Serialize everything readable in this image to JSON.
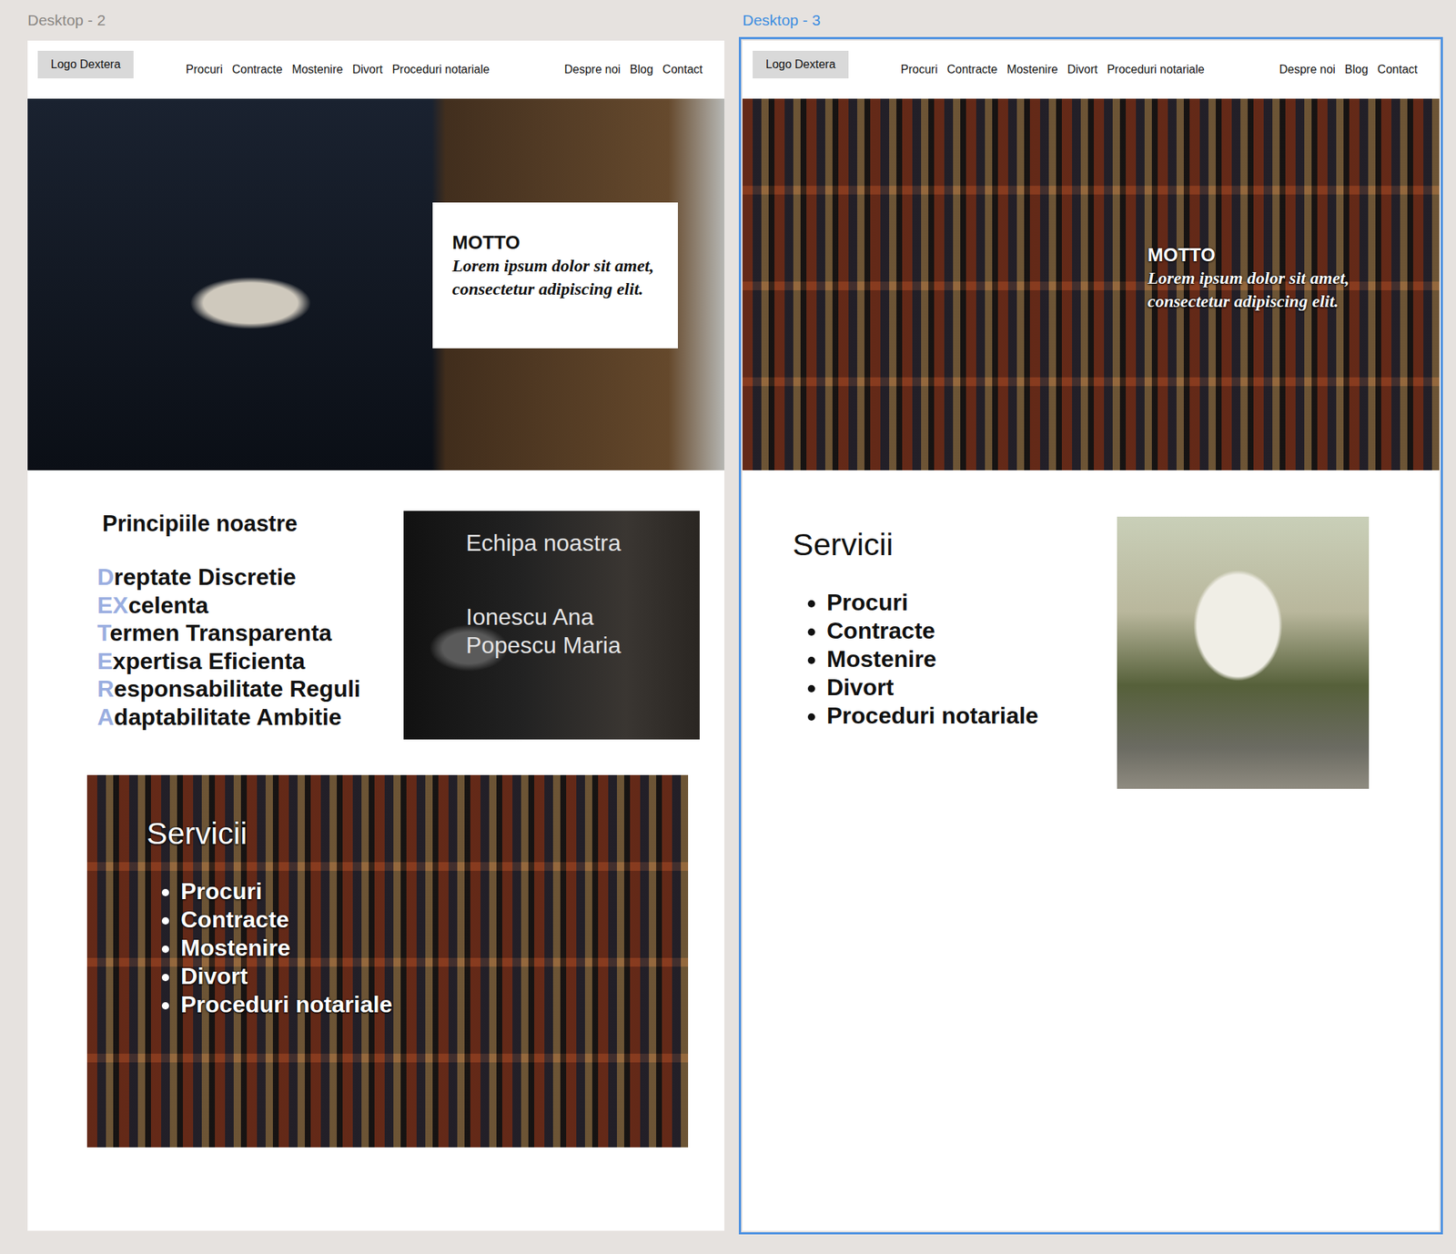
{
  "canvas": {
    "frames": [
      {
        "label": "Desktop - 2",
        "selected": false,
        "logo": "Logo Dextera",
        "nav_left": [
          "Procuri",
          "Contracte",
          "Mostenire",
          "Divort",
          "Proceduri notariale"
        ],
        "nav_right": [
          "Despre noi",
          "Blog",
          "Contact"
        ],
        "hero": {
          "kind": "card",
          "heading": "MOTTO",
          "tagline": "Lorem ipsum dolor sit amet, consectetur adipiscing elit."
        },
        "principles": {
          "title": "Principiile noastre",
          "items": [
            {
              "initial": "D",
              "rest": "reptate Discretie"
            },
            {
              "initial": "EX",
              "rest": "celenta"
            },
            {
              "initial": "T",
              "rest": "ermen Transparenta"
            },
            {
              "initial": "E",
              "rest": "xpertisa Eficienta"
            },
            {
              "initial": "R",
              "rest": "esponsabilitate Reguli"
            },
            {
              "initial": "A",
              "rest": "daptabilitate Ambitie"
            }
          ]
        },
        "team": {
          "title": "Echipa noastra",
          "members": [
            "Ionescu Ana",
            "Popescu Maria"
          ]
        },
        "services": {
          "kind": "overlay",
          "title": "Servicii",
          "items": [
            "Procuri",
            "Contracte",
            "Mostenire",
            "Divort",
            "Proceduri notariale"
          ]
        }
      },
      {
        "label": "Desktop - 3",
        "selected": true,
        "logo": "Logo Dextera",
        "nav_left": [
          "Procuri",
          "Contracte",
          "Mostenire",
          "Divort",
          "Proceduri notariale"
        ],
        "nav_right": [
          "Despre noi",
          "Blog",
          "Contact"
        ],
        "hero": {
          "kind": "overlay",
          "heading": "MOTTO",
          "tagline": "Lorem ipsum dolor sit amet, consectetur adipiscing elit."
        },
        "services": {
          "kind": "side",
          "title": "Servicii",
          "items": [
            "Procuri",
            "Contracte",
            "Mostenire",
            "Divort",
            "Proceduri notariale"
          ]
        }
      }
    ]
  }
}
